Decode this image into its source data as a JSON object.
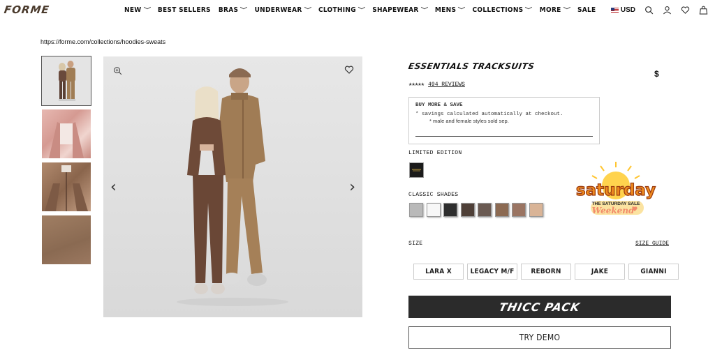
{
  "header": {
    "logo": "FORME",
    "nav": [
      {
        "label": "NEW",
        "dropdown": true
      },
      {
        "label": "BEST SELLERS",
        "dropdown": false
      },
      {
        "label": "BRAS",
        "dropdown": true
      },
      {
        "label": "UNDERWEAR",
        "dropdown": true
      },
      {
        "label": "CLOTHING",
        "dropdown": true
      },
      {
        "label": "SHAPEWEAR",
        "dropdown": true
      },
      {
        "label": "MENS",
        "dropdown": true
      },
      {
        "label": "COLLECTIONS",
        "dropdown": true
      },
      {
        "label": "MORE",
        "dropdown": true
      },
      {
        "label": "SALE",
        "dropdown": false
      }
    ],
    "currency": "USD",
    "icons": [
      "search-icon",
      "account-icon",
      "wishlist-heart-icon",
      "cart-bag-icon"
    ]
  },
  "url_text": "https://forme.com/collections/hoodies-sweats",
  "gallery": {
    "thumbnails": [
      "couple-tracksuit",
      "pink-hoodie-closeup",
      "brown-hoodie-closeup",
      "brown-fabric-swatch"
    ],
    "selected_index": 0
  },
  "product": {
    "title": "ESSENTIALS TRACKSUITS",
    "price": "$",
    "rating_stars": 5,
    "reviews_label": "494 REVIEWS",
    "promo": {
      "heading": "BUY MORE & SAVE",
      "line1": "* savings calculated automatically at checkout.",
      "line2": "*    male and female styles sold sep."
    },
    "limited_label": "LIMITED EDITION",
    "limited_swatches": [
      "#1b1b1b"
    ],
    "classic_label": "CLASSIC SHADES",
    "classic_swatches": [
      "#b9b9b9",
      "#f7f7f7",
      "#2e2e2e",
      "#4e3f37",
      "#6a5a52",
      "#8c6a52",
      "#9a7462",
      "#d9b497"
    ],
    "size_label": "SIZE",
    "size_guide_label": "SIZE GUIDE",
    "sizes": [
      "LARA X",
      "LEGACY M/F",
      "REBORN",
      "JAKE",
      "GIANNI"
    ],
    "primary_button": "THICC PACK",
    "secondary_button": "TRY DEMO"
  },
  "promo_badge": {
    "title": "saturday",
    "subtitle": "THE SATURDAY SALE",
    "tag": "Weekend"
  }
}
